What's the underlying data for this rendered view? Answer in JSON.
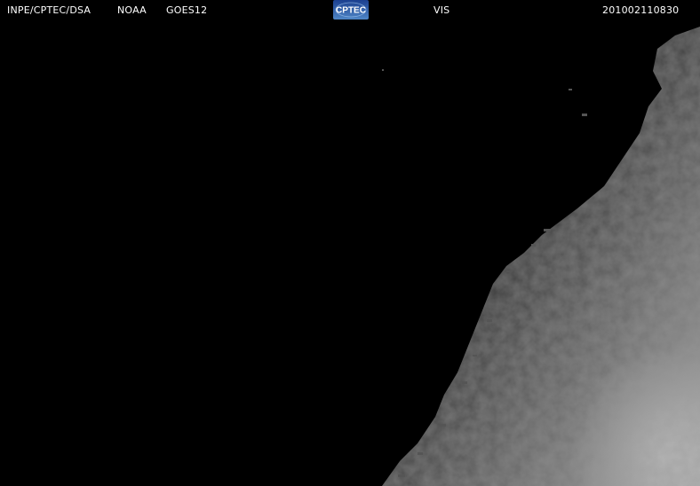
{
  "header": {
    "agency": "INPE/CPTEC/DSA",
    "provider": "NOAA",
    "satellite": "GOES12",
    "channel": "VIS",
    "timestamp": "201002110830"
  },
  "logo": {
    "text": "CPTEC",
    "colors": {
      "background_top": "#1b3f8f",
      "background_bottom": "#4f86c6",
      "text": "#ffffff"
    }
  },
  "image": {
    "background_color": "#000000",
    "earth_colors": [
      "#2a2a2a",
      "#4a4a4a",
      "#7a7a7a",
      "#a8a8a8"
    ]
  }
}
